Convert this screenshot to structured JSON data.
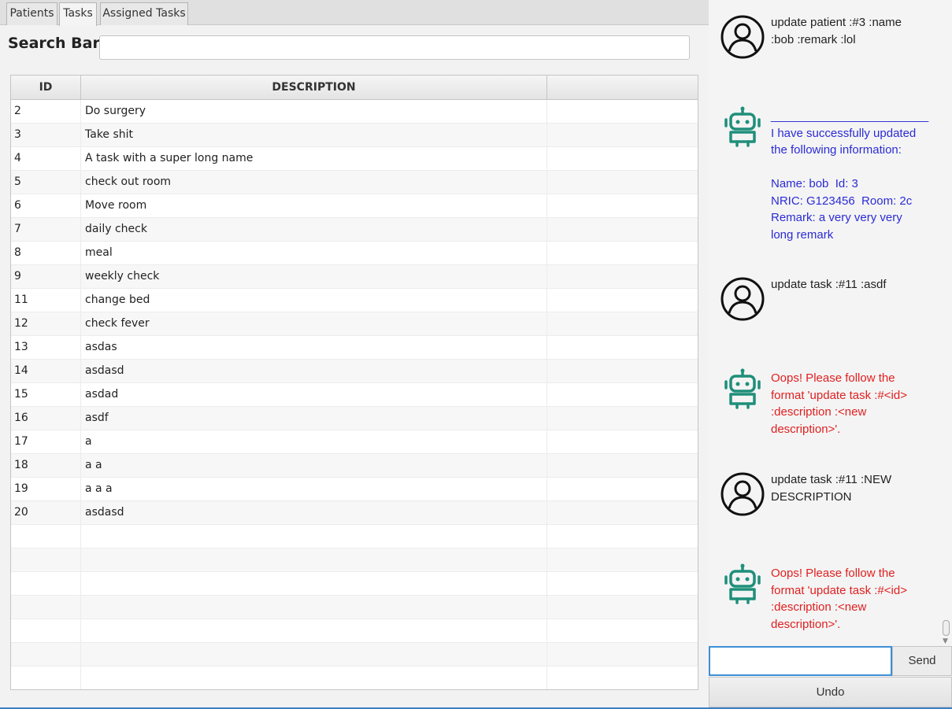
{
  "tabs": [
    {
      "label": "Patients"
    },
    {
      "label": "Tasks"
    },
    {
      "label": "Assigned Tasks"
    }
  ],
  "search": {
    "label": "Search Bar",
    "value": ""
  },
  "table": {
    "headers": {
      "id": "ID",
      "description": "DESCRIPTION",
      "extra": ""
    },
    "rows": [
      {
        "id": "2",
        "description": "Do surgery"
      },
      {
        "id": "3",
        "description": "Take shit"
      },
      {
        "id": "4",
        "description": "A task with a super long name"
      },
      {
        "id": "5",
        "description": "check out room"
      },
      {
        "id": "6",
        "description": "Move room"
      },
      {
        "id": "7",
        "description": "daily check"
      },
      {
        "id": "8",
        "description": "meal"
      },
      {
        "id": "9",
        "description": "weekly check"
      },
      {
        "id": "11",
        "description": "change bed"
      },
      {
        "id": "12",
        "description": "check fever"
      },
      {
        "id": "13",
        "description": "asdas"
      },
      {
        "id": "14",
        "description": "asdasd"
      },
      {
        "id": "15",
        "description": "asdad"
      },
      {
        "id": "16",
        "description": "asdf"
      },
      {
        "id": "17",
        "description": "a"
      },
      {
        "id": "18",
        "description": "a a"
      },
      {
        "id": "19",
        "description": "a a a"
      },
      {
        "id": "20",
        "description": "asdasd"
      }
    ]
  },
  "chat": {
    "messages": [
      {
        "sender": "user",
        "avatar_icon": "user-icon",
        "text": "update patient :#3 :name\n:bob :remark :lol"
      },
      {
        "sender": "bot",
        "status": "success",
        "avatar_icon": "robot-icon",
        "text": "________________________\nI have successfully updated\nthe following information:\n\nName: bob  Id: 3\nNRIC: G123456  Room: 2c\nRemark: a very very very\nlong remark"
      },
      {
        "sender": "user",
        "avatar_icon": "user-icon",
        "text": "update task :#11 :asdf"
      },
      {
        "sender": "bot",
        "status": "error",
        "avatar_icon": "robot-icon",
        "text": "Oops! Please follow the\nformat 'update task :#<id>\n:description :<new\ndescription>'."
      },
      {
        "sender": "user",
        "avatar_icon": "user-icon",
        "text": "update task :#11 :NEW\nDESCRIPTION"
      },
      {
        "sender": "bot",
        "status": "error",
        "avatar_icon": "robot-icon",
        "text": "Oops! Please follow the\nformat 'update task :#<id>\n:description :<new\ndescription>'."
      }
    ],
    "input_value": "",
    "send_label": "Send",
    "undo_label": "Undo"
  },
  "colors": {
    "bot_success": "#2b2bd6",
    "bot_error": "#e02020",
    "robot_teal": "#1e8f7a",
    "focus_blue": "#3d8fd6"
  }
}
